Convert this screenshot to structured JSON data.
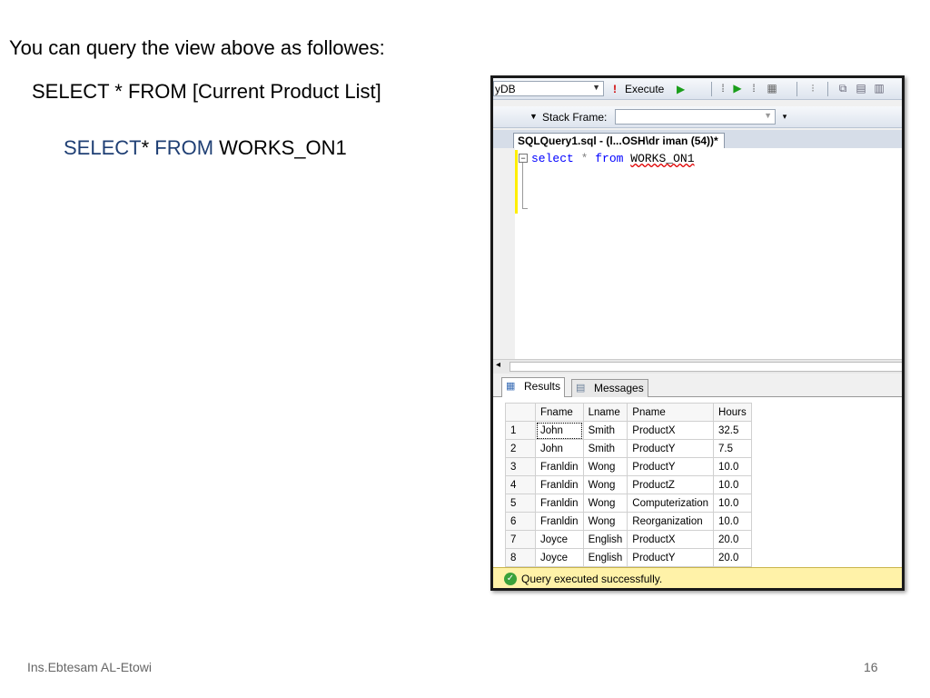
{
  "slide": {
    "heading": "You can query the view above as followes:",
    "example1": "SELECT * FROM [Current Product List]",
    "example2": {
      "kw1": "SELECT",
      "star": "*",
      "kw2": "FROM",
      "table": "WORKS_ON1"
    },
    "footer_left": "Ins.Ebtesam AL-Etowi",
    "page_number": "16"
  },
  "ssms": {
    "toolbar": {
      "database_value": "yDB",
      "execute_label": "Execute",
      "stack_frame_label": "Stack Frame:",
      "stack_frame_value": ""
    },
    "doc_tab_label": "SQLQuery1.sql - (l...OSH\\dr iman (54))*",
    "code": {
      "kw_select": "select",
      "op_star": "*",
      "kw_from": "from",
      "table": "WORKS_ON1"
    },
    "results_tabs": {
      "results": "Results",
      "messages": "Messages"
    },
    "grid": {
      "columns": [
        "Fname",
        "Lname",
        "Pname",
        "Hours"
      ],
      "rows": [
        [
          "1",
          "John",
          "Smith",
          "ProductX",
          "32.5"
        ],
        [
          "2",
          "John",
          "Smith",
          "ProductY",
          "7.5"
        ],
        [
          "3",
          "Franldin",
          "Wong",
          "ProductY",
          "10.0"
        ],
        [
          "4",
          "Franldin",
          "Wong",
          "ProductZ",
          "10.0"
        ],
        [
          "5",
          "Franldin",
          "Wong",
          "Computerization",
          "10.0"
        ],
        [
          "6",
          "Franldin",
          "Wong",
          "Reorganization",
          "10.0"
        ],
        [
          "7",
          "Joyce",
          "English",
          "ProductX",
          "20.0"
        ],
        [
          "8",
          "Joyce",
          "English",
          "ProductY",
          "20.0"
        ]
      ]
    },
    "status": "Query executed successfully.",
    "colors": {
      "status_bg": "#fff2a8",
      "keyword": "#0000ff",
      "slide_keyword": "#1f3f74",
      "change_bar": "#ffef00"
    }
  }
}
